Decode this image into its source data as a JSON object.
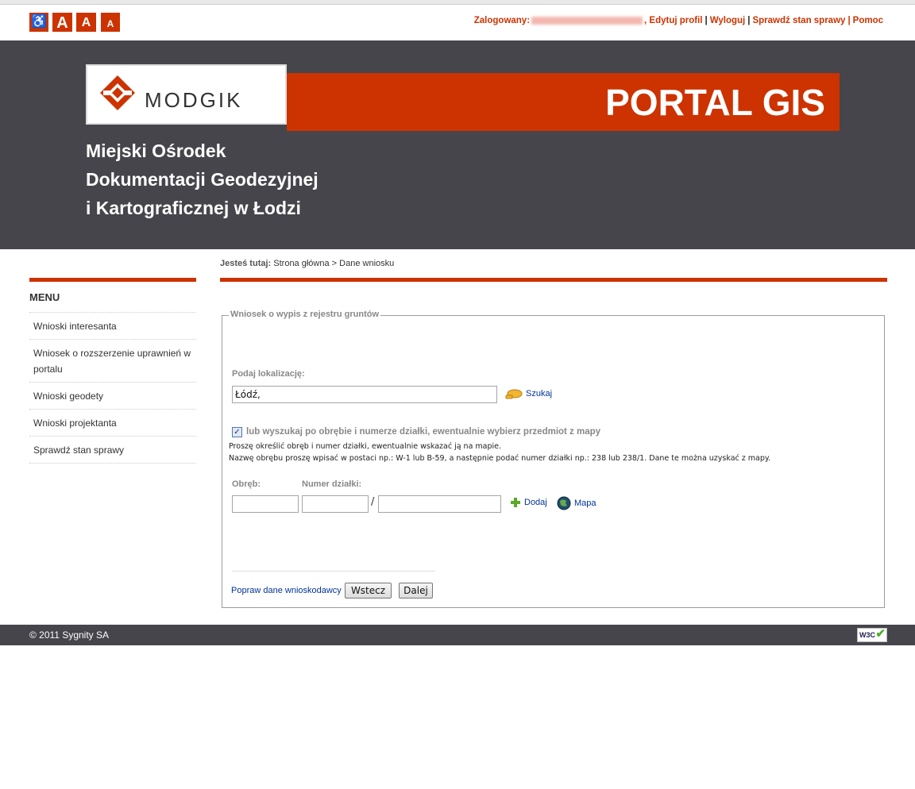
{
  "accessibility": {
    "wheelchair_glyph": "♿",
    "font_large": "A",
    "font_medium": "A",
    "font_small": "A"
  },
  "userbar": {
    "logged_label": "Zalogowany:",
    "edit_profile": "Edytuj profil",
    "logout": "Wyloguj",
    "check_status": "Sprawdź stan sprawy",
    "help": "Pomoc"
  },
  "header": {
    "logo_text": "MODGIK",
    "banner_title": "PORTAL GIS",
    "org_line1": "Miejski Ośrodek",
    "org_line2": "Dokumentacji Geodezyjnej",
    "org_line3": "i Kartograficznej w Łodzi"
  },
  "breadcrumb": {
    "label": "Jesteś tutaj:",
    "home": "Strona główna",
    "separator": ">",
    "current": "Dane wniosku"
  },
  "sidebar": {
    "title": "MENU",
    "items": [
      {
        "label": "Wnioski interesanta"
      },
      {
        "label": "Wniosek o rozszerzenie uprawnień w portalu"
      },
      {
        "label": "Wnioski geodety"
      },
      {
        "label": "Wnioski projektanta"
      },
      {
        "label": "Sprawdź stan sprawy"
      }
    ]
  },
  "form": {
    "legend": "Wniosek o wypis z rejestru gruntów",
    "location_label": "Podaj lokalizację:",
    "location_value": "Łódź,",
    "search_link": "Szukaj",
    "alt_search_checked": true,
    "alt_search_label": "lub wyszukaj po obrębie i numerze działki, ewentualnie wybierz przedmiot z mapy",
    "hint1": "Proszę określić obręb i numer działki, ewentualnie wskazać ją na mapie.",
    "hint2": "Nazwę obrębu proszę wpisać w postaci np.: W-1 lub B-59, a następnie podać numer działki np.: 238 lub 238/1. Dane te można uzyskać z mapy.",
    "precinct_label": "Obręb:",
    "parcel_label": "Numer działki:",
    "precinct_value": "",
    "parcel_value1": "",
    "parcel_value2": "",
    "slash": "/",
    "add_link": "Dodaj",
    "map_link": "Mapa",
    "fix_link": "Popraw dane wnioskodawcy",
    "back_button": "Wstecz",
    "next_button": "Dalej"
  },
  "footer": {
    "copyright": "© 2011 Sygnity SA",
    "w3c": "W3C"
  },
  "colors": {
    "accent": "#cc3300",
    "header_bg": "#45454b",
    "link": "#003399"
  }
}
